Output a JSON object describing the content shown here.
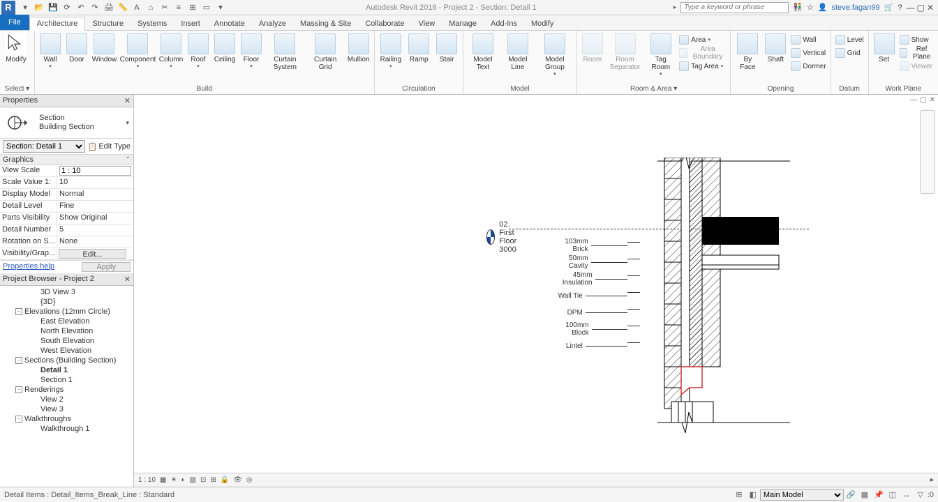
{
  "app": {
    "title": "Autodesk Revit 2018 -     Project 2 - Section: Detail 1",
    "search_placeholder": "Type a keyword or phrase",
    "username": "steve.fagan99"
  },
  "tabs": {
    "file": "File",
    "items": [
      "Architecture",
      "Structure",
      "Systems",
      "Insert",
      "Annotate",
      "Analyze",
      "Massing & Site",
      "Collaborate",
      "View",
      "Manage",
      "Add-Ins",
      "Modify"
    ],
    "active": "Architecture"
  },
  "ribbon": {
    "select": {
      "modify": "Modify",
      "label": "Select ▾"
    },
    "build": {
      "wall": "Wall",
      "door": "Door",
      "window": "Window",
      "component": "Component",
      "column": "Column",
      "roof": "Roof",
      "ceiling": "Ceiling",
      "floor": "Floor",
      "curtain_system": "Curtain System",
      "curtain_grid": "Curtain Grid",
      "mullion": "Mullion",
      "label": "Build"
    },
    "circulation": {
      "railing": "Railing",
      "ramp": "Ramp",
      "stair": "Stair",
      "label": "Circulation"
    },
    "model": {
      "model_text": "Model Text",
      "model_line": "Model Line",
      "model_group": "Model Group",
      "label": "Model"
    },
    "room_area": {
      "room": "Room",
      "room_separator": "Room Separator",
      "tag_room": "Tag Room",
      "area": "Area",
      "area_boundary": "Area Boundary",
      "tag_area": "Tag Area",
      "label": "Room & Area ▾"
    },
    "opening": {
      "by_face": "By Face",
      "shaft": "Shaft",
      "wall": "Wall",
      "vertical": "Vertical",
      "dormer": "Dormer",
      "label": "Opening"
    },
    "datum": {
      "level": "Level",
      "grid": "Grid",
      "label": "Datum"
    },
    "workplane": {
      "set": "Set",
      "show": "Show",
      "ref_plane": "Ref Plane",
      "viewer": "Viewer",
      "label": "Work Plane"
    }
  },
  "properties": {
    "title": "Properties",
    "type_family": "Section",
    "type_name": "Building Section",
    "instance": "Section: Detail 1",
    "edit_type": "Edit Type",
    "category": "Graphics",
    "rows": [
      {
        "k": "View Scale",
        "v": "1 : 10",
        "boxed": true
      },
      {
        "k": "Scale Value   1:",
        "v": "10"
      },
      {
        "k": "Display Model",
        "v": "Normal"
      },
      {
        "k": "Detail Level",
        "v": "Fine"
      },
      {
        "k": "Parts Visibility",
        "v": "Show Original"
      },
      {
        "k": "Detail Number",
        "v": "5"
      },
      {
        "k": "Rotation on S...",
        "v": "None"
      },
      {
        "k": "Visibility/Grap...",
        "v": "Edit...",
        "btn": true
      }
    ],
    "help": "Properties help",
    "apply": "Apply"
  },
  "browser": {
    "title": "Project Browser - Project 2",
    "nodes": [
      {
        "lvl": 3,
        "label": "3D View 3"
      },
      {
        "lvl": 3,
        "label": "{3D}"
      },
      {
        "lvl": 1,
        "exp": "-",
        "label": "Elevations (12mm Circle)"
      },
      {
        "lvl": 3,
        "label": "East Elevation"
      },
      {
        "lvl": 3,
        "label": "North Elevation"
      },
      {
        "lvl": 3,
        "label": "South Elevation"
      },
      {
        "lvl": 3,
        "label": "West Elevation"
      },
      {
        "lvl": 1,
        "exp": "-",
        "label": "Sections (Building Section)"
      },
      {
        "lvl": 3,
        "label": "Detail 1",
        "bold": true
      },
      {
        "lvl": 3,
        "label": "Section 1"
      },
      {
        "lvl": 1,
        "exp": "-",
        "label": "Renderings"
      },
      {
        "lvl": 3,
        "label": "View 2"
      },
      {
        "lvl": 3,
        "label": "View 3"
      },
      {
        "lvl": 1,
        "exp": "-",
        "label": "Walkthroughs"
      },
      {
        "lvl": 3,
        "label": "Walkthrough 1"
      }
    ]
  },
  "drawing": {
    "level_name": "02. First Floor",
    "level_elev": "3000",
    "annotations": [
      "103mm Brick",
      "50mm Cavity",
      "45mm Insulation",
      "Wall Tie",
      "DPM",
      "100mm Block",
      "Lintel"
    ]
  },
  "viewbar": {
    "scale": "1 : 10"
  },
  "status": {
    "left": "Detail Items : Detail_Items_Break_Line : Standard",
    "model": "Main Model",
    "sel_count": "0"
  }
}
